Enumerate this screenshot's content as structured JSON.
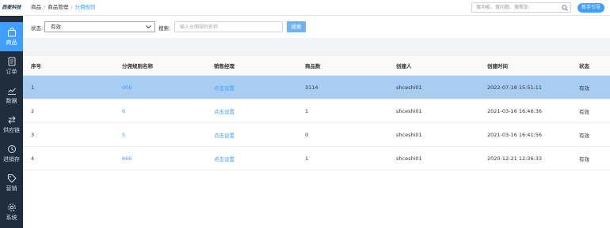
{
  "app": {
    "logo_text": "西麦科技"
  },
  "sidebar": {
    "items": [
      {
        "label": "商品",
        "icon": "bag-icon",
        "active": true
      },
      {
        "label": "订单",
        "icon": "order-icon",
        "active": false
      },
      {
        "label": "数据",
        "icon": "chart-icon",
        "active": false
      },
      {
        "label": "供应链",
        "icon": "exchange-icon",
        "active": false
      },
      {
        "label": "进销存",
        "icon": "inventory-icon",
        "active": false
      },
      {
        "label": "营销",
        "icon": "tag-icon",
        "active": false
      },
      {
        "label": "系统",
        "icon": "gear-icon",
        "active": false
      }
    ]
  },
  "header": {
    "breadcrumb": [
      "商品",
      "商品管理",
      "分佣规则"
    ],
    "search_placeholder": "搜功能、搜问题、搜帮肋",
    "guide_label": "新手引导"
  },
  "filters": {
    "status_label": "状态:",
    "status_value": "有效",
    "search_label": "搜索:",
    "search_placeholder": "输入分佣规则名称",
    "search_button": "搜索"
  },
  "table": {
    "columns": [
      "序号",
      "分佣规则名称",
      "销售经理",
      "商品数",
      "创建人",
      "创建时间",
      "状态"
    ],
    "rows": [
      {
        "index": "1",
        "name": "006",
        "manager": "点击设置",
        "count": "3114",
        "creator": "shceshi01",
        "created": "2022-07-18 15:51:11",
        "status": "有效",
        "selected": true
      },
      {
        "index": "2",
        "name": "6",
        "manager": "点击设置",
        "count": "1",
        "creator": "shceshi01",
        "created": "2021-03-16 16:46:36",
        "status": "有效",
        "selected": false
      },
      {
        "index": "3",
        "name": "5",
        "manager": "点击设置",
        "count": "0",
        "creator": "shceshi01",
        "created": "2021-03-16 16:41:56",
        "status": "有效",
        "selected": false
      },
      {
        "index": "4",
        "name": "666",
        "manager": "点击设置",
        "count": "1",
        "creator": "shceshi01",
        "created": "2020-12-21 12:36:33",
        "status": "有效",
        "selected": false
      }
    ]
  },
  "colors": {
    "accent": "#409eff",
    "sidebar_bg": "#1f2d3d",
    "selected_row": "#a9cdf2"
  }
}
